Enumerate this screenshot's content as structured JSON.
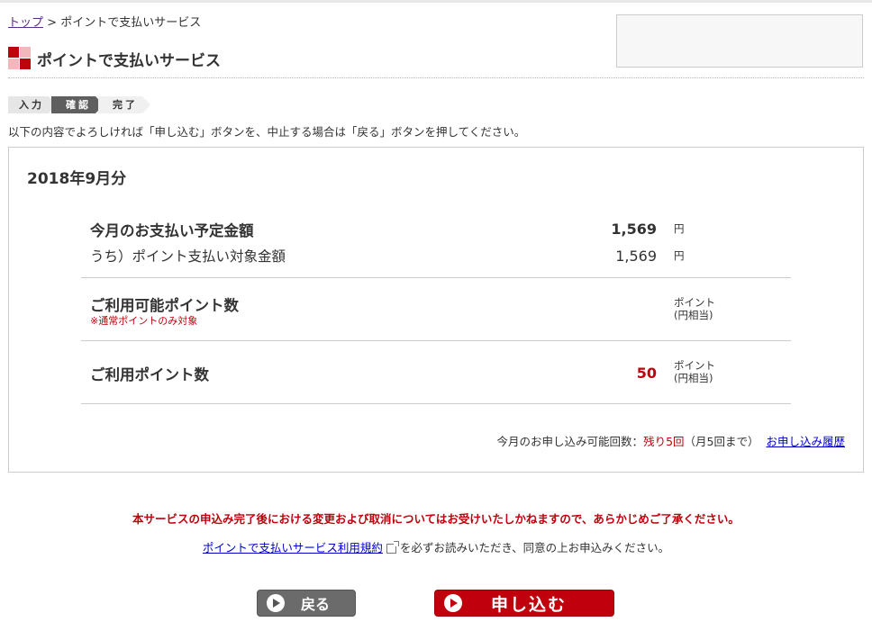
{
  "breadcrumb": {
    "home": "トップ",
    "separator": ">",
    "current": "ポイントで支払いサービス"
  },
  "page": {
    "title": "ポイントで支払いサービス"
  },
  "steps": [
    {
      "label": "入力"
    },
    {
      "label": "確認"
    },
    {
      "label": "完了"
    }
  ],
  "instruction": "以下の内容でよろしければ「申し込む」ボタンを、中止する場合は「戻る」ボタンを押してください。",
  "summary": {
    "month": "2018年9月分",
    "scheduled_label": "今月のお支払い予定金額",
    "scheduled_value": "1,569",
    "scheduled_unit": "円",
    "target_label": "うち）ポイント支払い対象金額",
    "target_value": "1,569",
    "target_unit": "円",
    "available_label": "ご利用可能ポイント数",
    "available_note": "※通常ポイントのみ対象",
    "available_unit_line1": "ポイント",
    "available_unit_line2": "(円相当)",
    "use_label": "ご利用ポイント数",
    "use_value": "50",
    "use_unit_line1": "ポイント",
    "use_unit_line2": "(円相当)"
  },
  "remaining": {
    "prefix": "今月のお申し込み可能回数：",
    "count": "残り5回",
    "suffix": "（月5回まで）",
    "history_link": "お申し込み履歴"
  },
  "warning": "本サービスの申込み完了後における変更および取消についてはお受けいたしかねますので、あらかじめご了承ください。",
  "terms": {
    "link": "ポイントで支払いサービス利用規約",
    "suffix": "を必ずお読みいただき、同意の上お申込みください。"
  },
  "buttons": {
    "back": "戻る",
    "apply": "申し込む"
  },
  "colors": {
    "accent_red": "#c0000c",
    "link_blue": "#0000cc",
    "back_button": "#6b6b6b"
  }
}
